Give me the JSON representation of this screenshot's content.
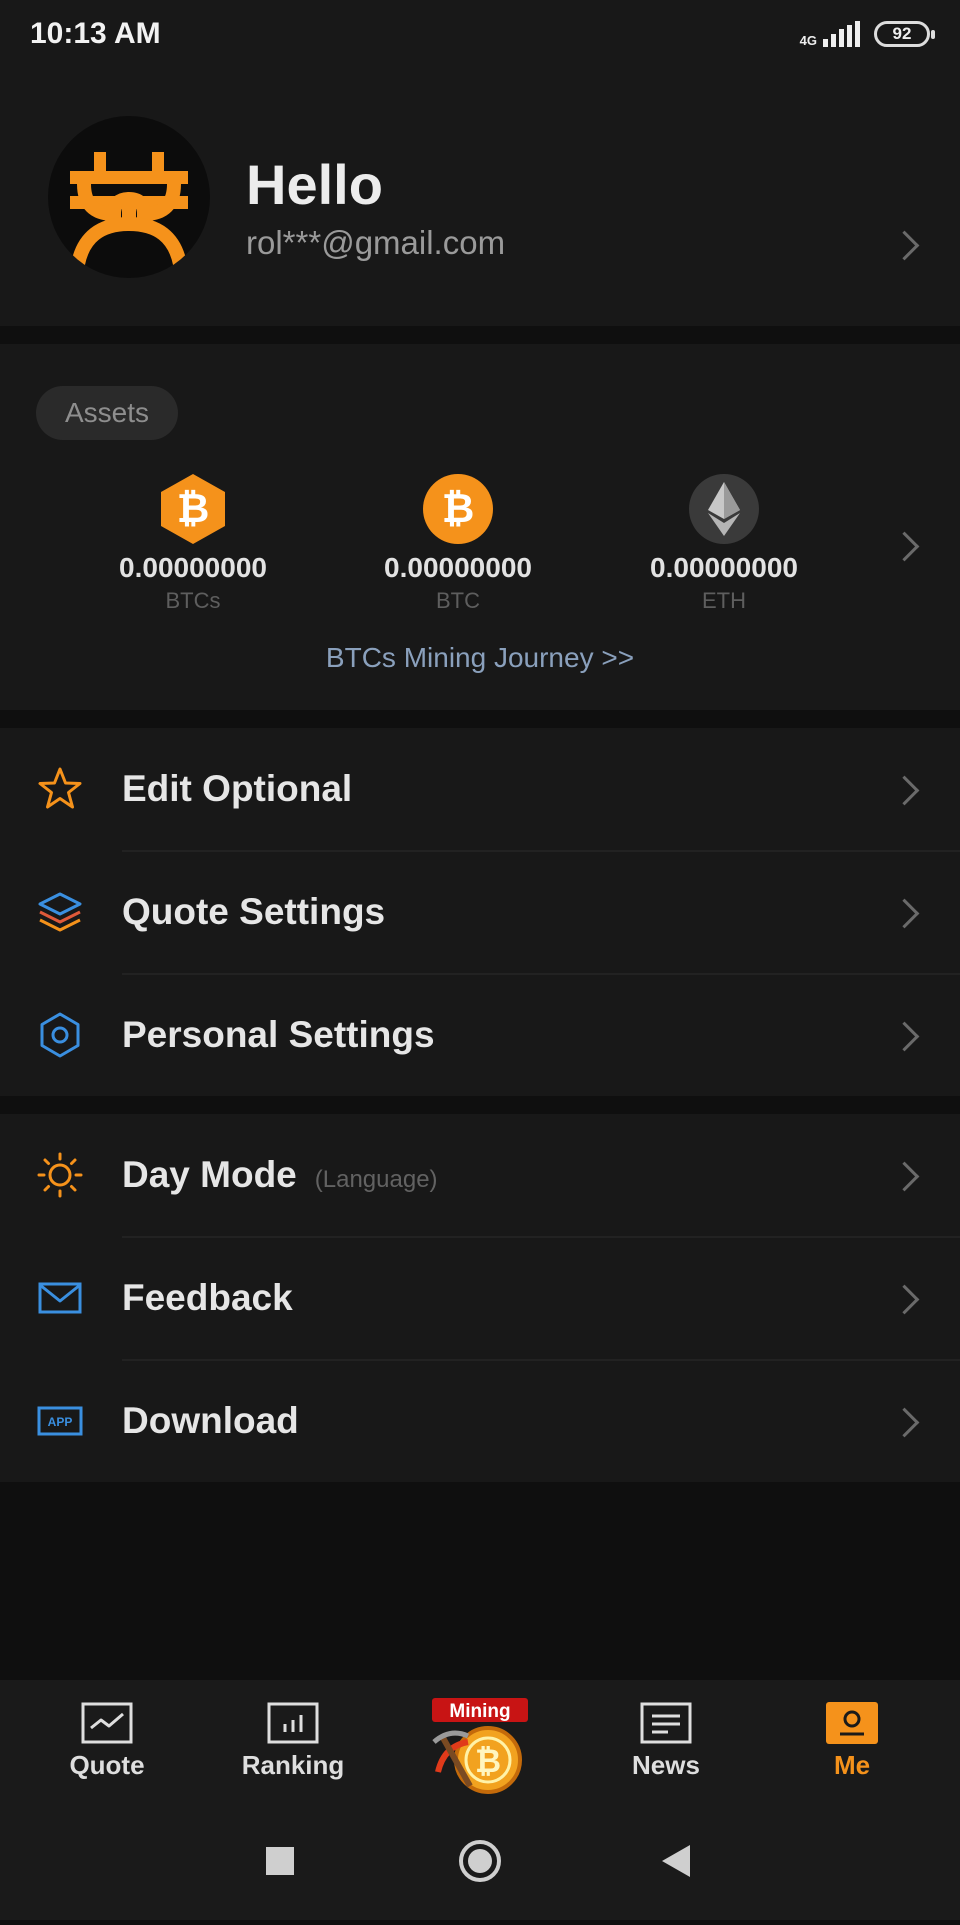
{
  "status": {
    "time": "10:13 AM",
    "network": "4G",
    "battery": "92"
  },
  "profile": {
    "greeting": "Hello",
    "email": "rol***@gmail.com"
  },
  "assets": {
    "pill_label": "Assets",
    "items": [
      {
        "value": "0.00000000",
        "symbol": "BTCs",
        "icon": "btcs-hexagon-icon"
      },
      {
        "value": "0.00000000",
        "symbol": "BTC",
        "icon": "bitcoin-icon"
      },
      {
        "value": "0.00000000",
        "symbol": "ETH",
        "icon": "ethereum-icon"
      }
    ],
    "journey_link": "BTCs Mining Journey >>"
  },
  "menu_group_1": [
    {
      "label": "Edit Optional",
      "icon": "star-icon"
    },
    {
      "label": "Quote Settings",
      "icon": "layers-icon"
    },
    {
      "label": "Personal Settings",
      "icon": "hexagon-settings-icon"
    }
  ],
  "menu_group_2": [
    {
      "label": "Day Mode",
      "sub": "(Language)",
      "icon": "sun-icon"
    },
    {
      "label": "Feedback",
      "icon": "envelope-icon"
    },
    {
      "label": "Download",
      "icon": "app-icon",
      "icon_text": "APP"
    }
  ],
  "tabbar": {
    "tabs": [
      {
        "label": "Quote",
        "icon": "chart-line-icon"
      },
      {
        "label": "Ranking",
        "icon": "bar-chart-icon"
      },
      {
        "label": "",
        "icon": "mining-bitcoin-icon",
        "badge_text": "Mining"
      },
      {
        "label": "News",
        "icon": "news-icon"
      },
      {
        "label": "Me",
        "icon": "person-icon"
      }
    ],
    "active_index": 4
  },
  "colors": {
    "accent": "#f5921b",
    "link": "#8aa0bc",
    "background": "#181818"
  }
}
